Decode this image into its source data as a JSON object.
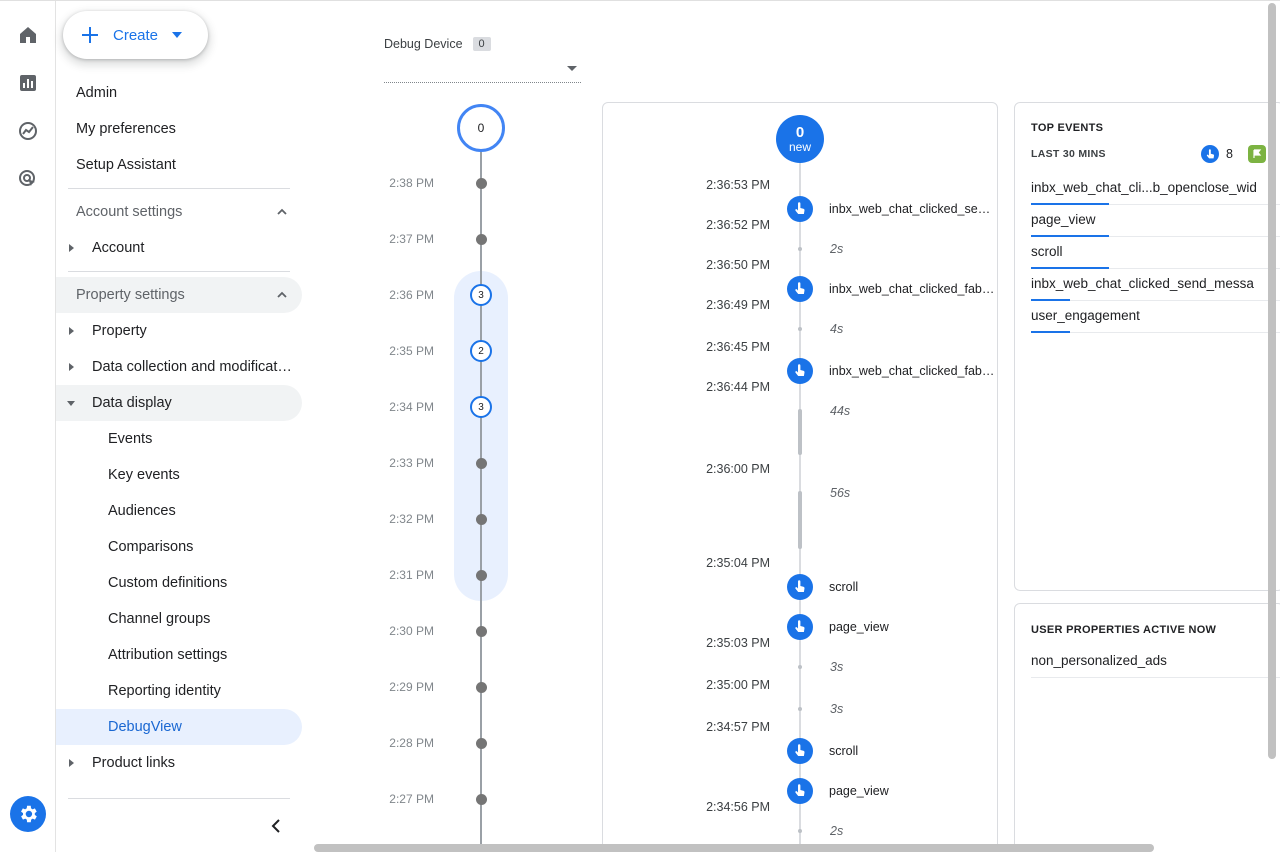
{
  "nav": {
    "create_label": "Create",
    "admin": "Admin",
    "my_preferences": "My preferences",
    "setup_assistant": "Setup Assistant",
    "account_settings": "Account settings",
    "account": "Account",
    "property_settings": "Property settings",
    "property": "Property",
    "data_collection": "Data collection and modificat…",
    "data_display": "Data display",
    "sub_items": [
      "Events",
      "Key events",
      "Audiences",
      "Comparisons",
      "Custom definitions",
      "Channel groups",
      "Attribution settings",
      "Reporting identity",
      "DebugView"
    ],
    "product_links": "Product links"
  },
  "debug": {
    "device_label": "Debug Device",
    "device_count": "0"
  },
  "minutes": {
    "top_count": "0",
    "rows": [
      {
        "time": "2:38 PM",
        "count": ""
      },
      {
        "time": "2:37 PM",
        "count": ""
      },
      {
        "time": "2:36 PM",
        "count": "3"
      },
      {
        "time": "2:35 PM",
        "count": "2"
      },
      {
        "time": "2:34 PM",
        "count": "3"
      },
      {
        "time": "2:33 PM",
        "count": ""
      },
      {
        "time": "2:32 PM",
        "count": ""
      },
      {
        "time": "2:31 PM",
        "count": ""
      },
      {
        "time": "2:30 PM",
        "count": ""
      },
      {
        "time": "2:29 PM",
        "count": ""
      },
      {
        "time": "2:28 PM",
        "count": ""
      },
      {
        "time": "2:27 PM",
        "count": ""
      }
    ]
  },
  "stream": {
    "new_count": "0",
    "new_label": "new",
    "times": [
      "2:36:53 PM",
      "2:36:52 PM",
      "2:36:50 PM",
      "2:36:49 PM",
      "2:36:45 PM",
      "2:36:44 PM",
      "2:36:00 PM",
      "2:35:04 PM",
      "2:35:03 PM",
      "2:35:00 PM",
      "2:34:57 PM",
      "2:34:56 PM"
    ],
    "gaps": [
      "2s",
      "4s",
      "44s",
      "56s",
      "3s",
      "3s",
      "2s"
    ],
    "events": [
      "inbx_web_chat_clicked_se…",
      "inbx_web_chat_clicked_fab…",
      "inbx_web_chat_clicked_fab…",
      "scroll",
      "page_view",
      "scroll",
      "page_view"
    ]
  },
  "top_events": {
    "title": "TOP EVENTS",
    "subtitle": "LAST 30 MINS",
    "event_count": "8",
    "items": [
      {
        "name": "inbx_web_chat_cli...b_openclose_wid",
        "share": 0.3
      },
      {
        "name": "page_view",
        "share": 0.3
      },
      {
        "name": "scroll",
        "share": 0.3
      },
      {
        "name": "inbx_web_chat_clicked_send_messa",
        "share": 0.15
      },
      {
        "name": "user_engagement",
        "share": 0.15
      }
    ]
  },
  "user_properties": {
    "title": "USER PROPERTIES ACTIVE NOW",
    "items": [
      "non_personalized_ads"
    ]
  },
  "colors": {
    "accent": "#1a73e8",
    "flag": "#7cb342"
  }
}
